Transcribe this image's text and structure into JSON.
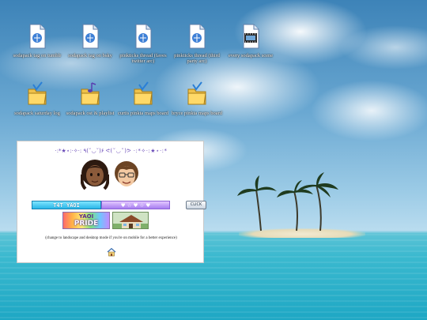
{
  "desktop": {
    "icons": [
      {
        "label": "sodapack tag on tumblr",
        "icon": "document-icon"
      },
      {
        "label": "sodapack tag on bsky",
        "icon": "document-icon"
      },
      {
        "label": "pinkticks thread (faves twitter arc)",
        "icon": "document-icon"
      },
      {
        "label": "pinkticks thread (third party arc)",
        "icon": "document-icon"
      },
      {
        "label": "every sodapack scene",
        "icon": "video-icon"
      },
      {
        "label": "sodapack saturday log",
        "icon": "folder-icon"
      },
      {
        "label": "sodapack ost & playlist",
        "icon": "music-folder-icon"
      },
      {
        "label": "curtis pinkta maps board",
        "icon": "folder-icon"
      },
      {
        "label": "bryce pinkta maps board",
        "icon": "folder-icon"
      }
    ]
  },
  "panel": {
    "decoration": "·:*★⋆:·✧·: ٩(˘◡˘)۶ ᕙ(˘◡˘)ᕗ ·:*✧·:★⋆·:*",
    "badge_left": "T4T YAOI",
    "badge_mid": "♥ ☆ ♥ ☆ ♥",
    "badge_btn": "CLICK",
    "stamp_top": "YAOI",
    "stamp_bottom": "PRIDE",
    "caption": "(change to landscape and desktop mode if you're on mobile for a better experience)"
  }
}
